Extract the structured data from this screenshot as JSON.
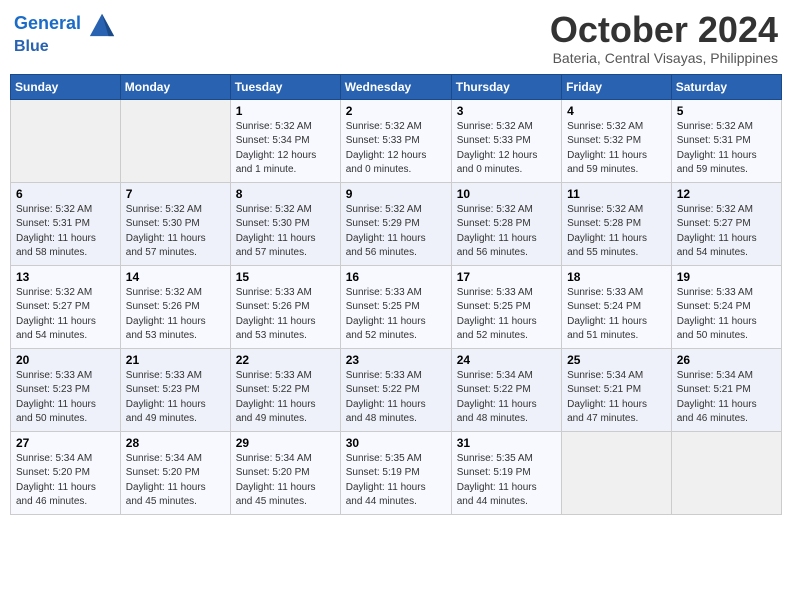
{
  "header": {
    "logo_line1": "General",
    "logo_line2": "Blue",
    "month": "October 2024",
    "location": "Bateria, Central Visayas, Philippines"
  },
  "weekdays": [
    "Sunday",
    "Monday",
    "Tuesday",
    "Wednesday",
    "Thursday",
    "Friday",
    "Saturday"
  ],
  "weeks": [
    [
      {
        "day": "",
        "info": ""
      },
      {
        "day": "",
        "info": ""
      },
      {
        "day": "1",
        "info": "Sunrise: 5:32 AM\nSunset: 5:34 PM\nDaylight: 12 hours\nand 1 minute."
      },
      {
        "day": "2",
        "info": "Sunrise: 5:32 AM\nSunset: 5:33 PM\nDaylight: 12 hours\nand 0 minutes."
      },
      {
        "day": "3",
        "info": "Sunrise: 5:32 AM\nSunset: 5:33 PM\nDaylight: 12 hours\nand 0 minutes."
      },
      {
        "day": "4",
        "info": "Sunrise: 5:32 AM\nSunset: 5:32 PM\nDaylight: 11 hours\nand 59 minutes."
      },
      {
        "day": "5",
        "info": "Sunrise: 5:32 AM\nSunset: 5:31 PM\nDaylight: 11 hours\nand 59 minutes."
      }
    ],
    [
      {
        "day": "6",
        "info": "Sunrise: 5:32 AM\nSunset: 5:31 PM\nDaylight: 11 hours\nand 58 minutes."
      },
      {
        "day": "7",
        "info": "Sunrise: 5:32 AM\nSunset: 5:30 PM\nDaylight: 11 hours\nand 57 minutes."
      },
      {
        "day": "8",
        "info": "Sunrise: 5:32 AM\nSunset: 5:30 PM\nDaylight: 11 hours\nand 57 minutes."
      },
      {
        "day": "9",
        "info": "Sunrise: 5:32 AM\nSunset: 5:29 PM\nDaylight: 11 hours\nand 56 minutes."
      },
      {
        "day": "10",
        "info": "Sunrise: 5:32 AM\nSunset: 5:28 PM\nDaylight: 11 hours\nand 56 minutes."
      },
      {
        "day": "11",
        "info": "Sunrise: 5:32 AM\nSunset: 5:28 PM\nDaylight: 11 hours\nand 55 minutes."
      },
      {
        "day": "12",
        "info": "Sunrise: 5:32 AM\nSunset: 5:27 PM\nDaylight: 11 hours\nand 54 minutes."
      }
    ],
    [
      {
        "day": "13",
        "info": "Sunrise: 5:32 AM\nSunset: 5:27 PM\nDaylight: 11 hours\nand 54 minutes."
      },
      {
        "day": "14",
        "info": "Sunrise: 5:32 AM\nSunset: 5:26 PM\nDaylight: 11 hours\nand 53 minutes."
      },
      {
        "day": "15",
        "info": "Sunrise: 5:33 AM\nSunset: 5:26 PM\nDaylight: 11 hours\nand 53 minutes."
      },
      {
        "day": "16",
        "info": "Sunrise: 5:33 AM\nSunset: 5:25 PM\nDaylight: 11 hours\nand 52 minutes."
      },
      {
        "day": "17",
        "info": "Sunrise: 5:33 AM\nSunset: 5:25 PM\nDaylight: 11 hours\nand 52 minutes."
      },
      {
        "day": "18",
        "info": "Sunrise: 5:33 AM\nSunset: 5:24 PM\nDaylight: 11 hours\nand 51 minutes."
      },
      {
        "day": "19",
        "info": "Sunrise: 5:33 AM\nSunset: 5:24 PM\nDaylight: 11 hours\nand 50 minutes."
      }
    ],
    [
      {
        "day": "20",
        "info": "Sunrise: 5:33 AM\nSunset: 5:23 PM\nDaylight: 11 hours\nand 50 minutes."
      },
      {
        "day": "21",
        "info": "Sunrise: 5:33 AM\nSunset: 5:23 PM\nDaylight: 11 hours\nand 49 minutes."
      },
      {
        "day": "22",
        "info": "Sunrise: 5:33 AM\nSunset: 5:22 PM\nDaylight: 11 hours\nand 49 minutes."
      },
      {
        "day": "23",
        "info": "Sunrise: 5:33 AM\nSunset: 5:22 PM\nDaylight: 11 hours\nand 48 minutes."
      },
      {
        "day": "24",
        "info": "Sunrise: 5:34 AM\nSunset: 5:22 PM\nDaylight: 11 hours\nand 48 minutes."
      },
      {
        "day": "25",
        "info": "Sunrise: 5:34 AM\nSunset: 5:21 PM\nDaylight: 11 hours\nand 47 minutes."
      },
      {
        "day": "26",
        "info": "Sunrise: 5:34 AM\nSunset: 5:21 PM\nDaylight: 11 hours\nand 46 minutes."
      }
    ],
    [
      {
        "day": "27",
        "info": "Sunrise: 5:34 AM\nSunset: 5:20 PM\nDaylight: 11 hours\nand 46 minutes."
      },
      {
        "day": "28",
        "info": "Sunrise: 5:34 AM\nSunset: 5:20 PM\nDaylight: 11 hours\nand 45 minutes."
      },
      {
        "day": "29",
        "info": "Sunrise: 5:34 AM\nSunset: 5:20 PM\nDaylight: 11 hours\nand 45 minutes."
      },
      {
        "day": "30",
        "info": "Sunrise: 5:35 AM\nSunset: 5:19 PM\nDaylight: 11 hours\nand 44 minutes."
      },
      {
        "day": "31",
        "info": "Sunrise: 5:35 AM\nSunset: 5:19 PM\nDaylight: 11 hours\nand 44 minutes."
      },
      {
        "day": "",
        "info": ""
      },
      {
        "day": "",
        "info": ""
      }
    ]
  ]
}
